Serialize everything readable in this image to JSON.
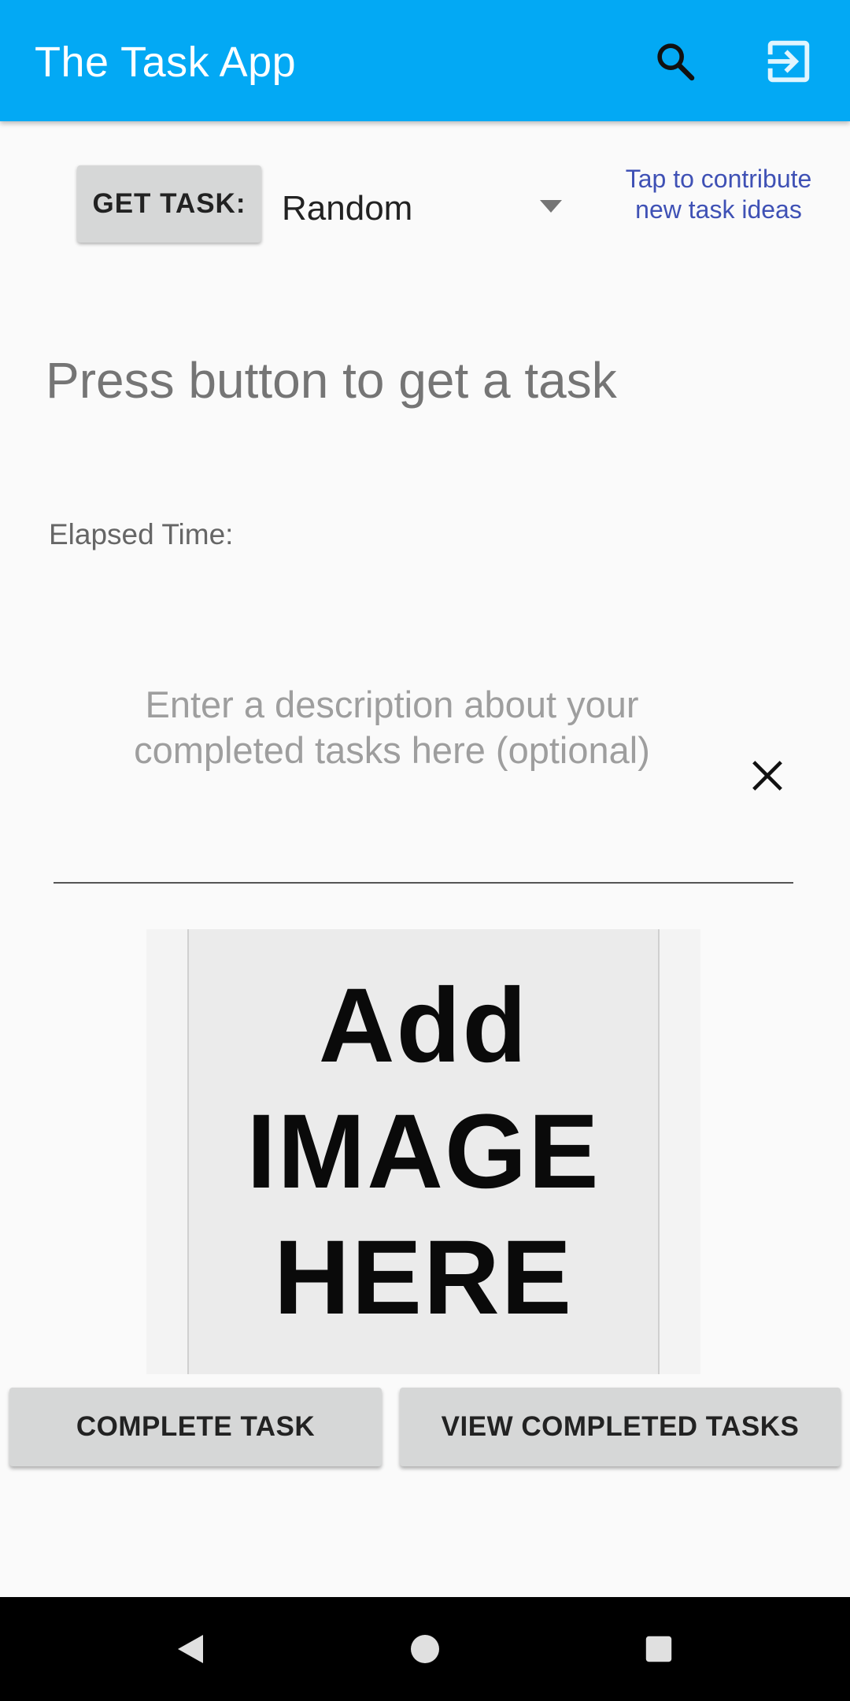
{
  "appbar": {
    "title": "The Task App",
    "search_icon": "search-icon",
    "exit_icon": "exit-to-app-icon",
    "color": "#03a9f4"
  },
  "task_controls": {
    "get_task_label": "GET TASK:",
    "category_selected": "Random",
    "contribute_link": "Tap to contribute new task ideas"
  },
  "task": {
    "prompt": "Press button to get a task",
    "elapsed_label": "Elapsed Time:"
  },
  "description": {
    "placeholder": "Enter a description about your completed tasks here (optional)",
    "clear_icon": "close-icon"
  },
  "image_placeholder": {
    "lines": [
      "Add",
      "IMAGE",
      "HERE"
    ]
  },
  "actions": {
    "complete_label": "COMPLETE TASK",
    "view_completed_label": "VIEW COMPLETED TASKS"
  },
  "navbar": {
    "back_icon": "back-triangle-icon",
    "home_icon": "home-circle-icon",
    "recents_icon": "recents-square-icon"
  }
}
